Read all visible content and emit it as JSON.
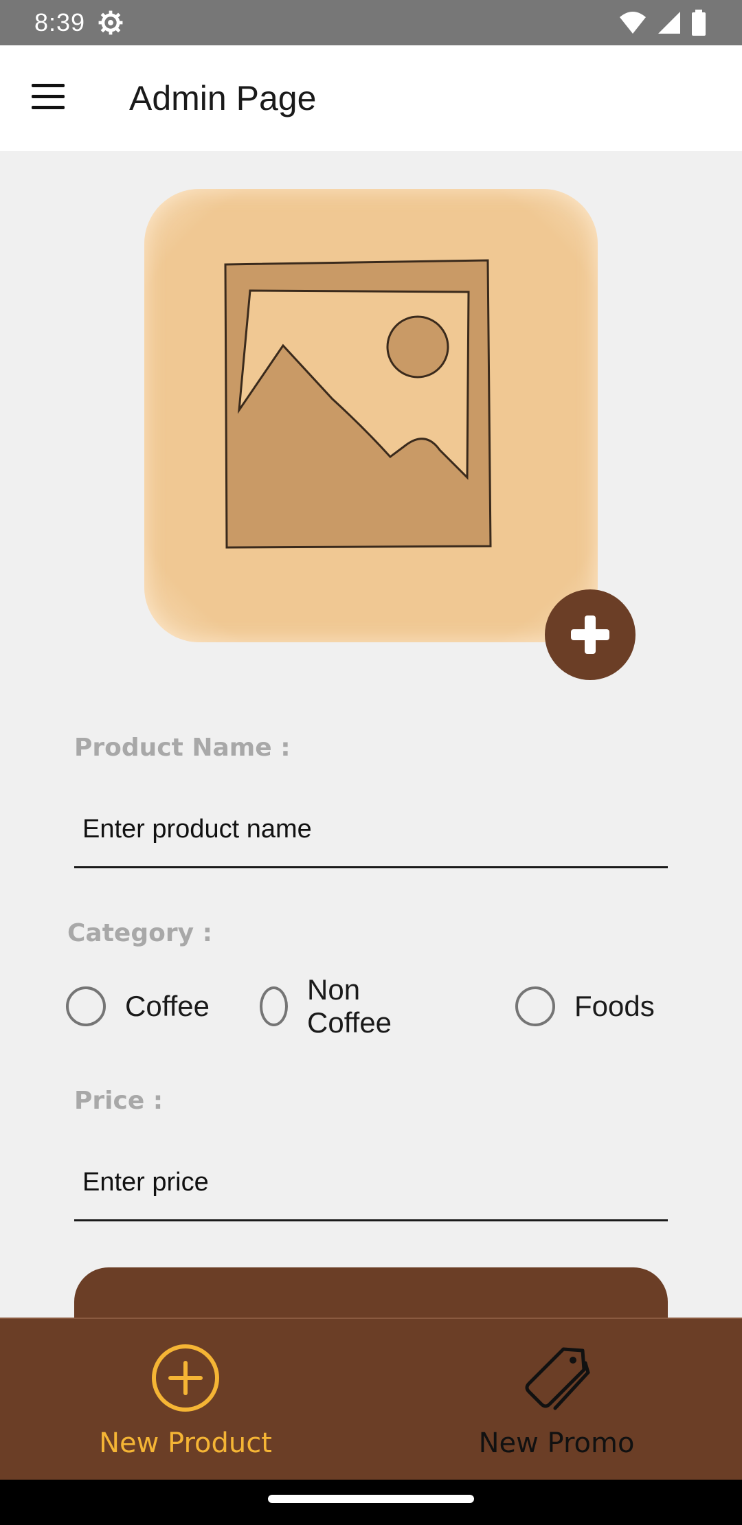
{
  "status_bar": {
    "time": "8:39",
    "icons": [
      "settings-gear-icon",
      "wifi-icon",
      "signal-icon",
      "battery-icon"
    ]
  },
  "app_bar": {
    "title": "Admin Page",
    "menu_icon": "hamburger-menu-icon"
  },
  "product_image": {
    "placeholder_icon": "image-placeholder-icon",
    "add_icon": "plus-icon"
  },
  "form": {
    "product_name_label": "Product Name :",
    "product_name_placeholder": "Enter product name",
    "category_label": "Category :",
    "categories": [
      "Coffee",
      "Non Coffee",
      "Foods"
    ],
    "price_label": "Price :",
    "price_placeholder": "Enter price"
  },
  "bottom_nav": {
    "items": [
      {
        "label": "New Product",
        "icon": "add-circle-icon",
        "active": true
      },
      {
        "label": "New Promo",
        "icon": "tag-icon",
        "active": false
      }
    ]
  },
  "colors": {
    "primary_brown": "#6b3e26",
    "accent_yellow": "#f5b535",
    "image_bg": "#f0c893",
    "label_gray": "#a8a8a8"
  }
}
